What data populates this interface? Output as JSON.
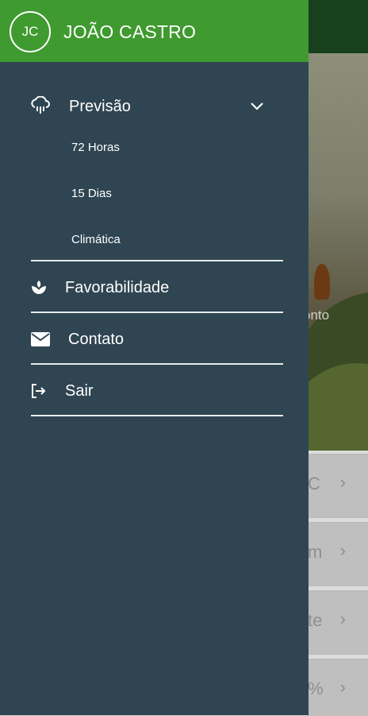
{
  "user": {
    "initials": "JC",
    "name": "JOÃO CASTRO"
  },
  "menu": {
    "previsao": {
      "label": "Previsão",
      "icon": "cloud-rain-icon",
      "expanded": true,
      "subitems": [
        "72 Horas",
        "15 Dias",
        "Climática"
      ]
    },
    "favorabilidade": {
      "label": "Favorabilidade",
      "icon": "leaf-hand-icon"
    },
    "contato": {
      "label": "Contato",
      "icon": "mail-icon"
    },
    "sair": {
      "label": "Sair",
      "icon": "logout-icon"
    }
  },
  "background": {
    "hero_text": "onto",
    "cards": [
      "C",
      "m",
      "te",
      "%"
    ]
  },
  "colors": {
    "header": "#3f9a2f",
    "drawer": "#2f4551",
    "dim_topbar": "#17401d"
  }
}
